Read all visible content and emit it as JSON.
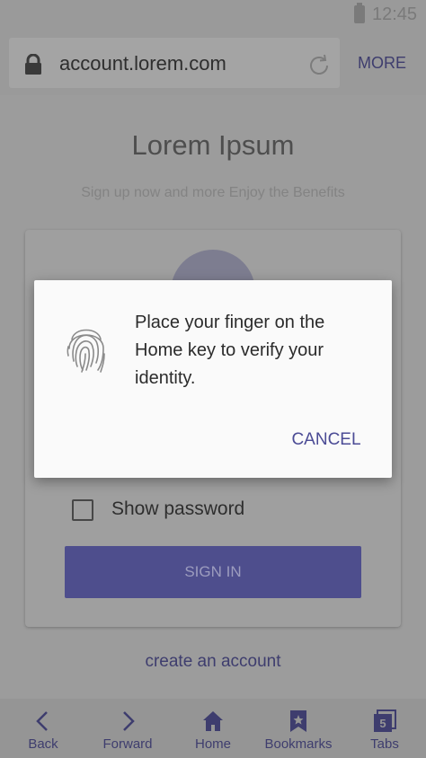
{
  "status_bar": {
    "time": "12:45",
    "battery_icon": "battery-icon"
  },
  "browser": {
    "url": "account.lorem.com",
    "more_label": "MORE",
    "lock_icon": "lock-icon",
    "reload_icon": "reload-icon"
  },
  "page": {
    "title": "Lorem Ipsum",
    "subtitle": "Sign up now and more Enjoy the Benefits",
    "show_password_label": "Show password",
    "signin_label": "SIGN IN",
    "create_account_label": "create an account"
  },
  "dialog": {
    "message": "Place your finger on the Home key to verify your identity.",
    "cancel_label": "CANCEL",
    "icon": "fingerprint-icon"
  },
  "bottom_nav": {
    "items": [
      {
        "label": "Back",
        "icon": "back-icon"
      },
      {
        "label": "Forward",
        "icon": "forward-icon"
      },
      {
        "label": "Home",
        "icon": "home-icon"
      },
      {
        "label": "Bookmarks",
        "icon": "bookmark-icon"
      },
      {
        "label": "Tabs",
        "icon": "tabs-icon",
        "badge": "5"
      }
    ]
  },
  "colors": {
    "accent": "#4b4b95",
    "dialog_background": "#fafafa",
    "dimmed_background": "#9a9a9a"
  }
}
